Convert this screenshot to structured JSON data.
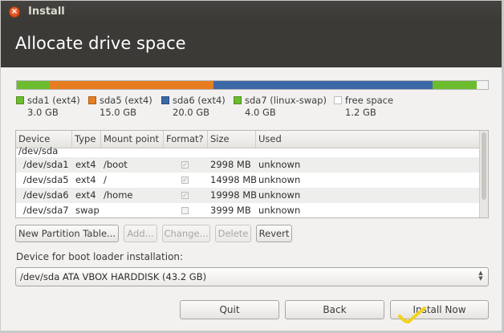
{
  "window": {
    "title": "Install",
    "close_icon": "close-icon"
  },
  "header": {
    "title": "Allocate drive space"
  },
  "partition_bar": {
    "segments": [
      {
        "name": "sda1",
        "fraction": 0.069,
        "color": "#6bbd2d"
      },
      {
        "name": "sda5",
        "fraction": 0.349,
        "color": "#e67d21"
      },
      {
        "name": "sda6",
        "fraction": 0.465,
        "color": "#3d68a6"
      },
      {
        "name": "sda7",
        "fraction": 0.093,
        "color": "#6bbd2d"
      },
      {
        "name": "free",
        "fraction": 0.024,
        "color": "#f4f4f4"
      }
    ]
  },
  "legend": [
    {
      "name": "sda1 (ext4)",
      "size": "3.0 GB",
      "color": "#6bbd2d"
    },
    {
      "name": "sda5 (ext4)",
      "size": "15.0 GB",
      "color": "#e67d21"
    },
    {
      "name": "sda6 (ext4)",
      "size": "20.0 GB",
      "color": "#3d68a6"
    },
    {
      "name": "sda7 (linux-swap)",
      "size": "4.0 GB",
      "color": "#6bbd2d"
    },
    {
      "name": "free space",
      "size": "1.2 GB",
      "color": "#ffffff"
    }
  ],
  "table": {
    "headers": [
      "Device",
      "Type",
      "Mount point",
      "Format?",
      "Size",
      "Used"
    ],
    "group": "/dev/sda",
    "rows": [
      {
        "device": "/dev/sda1",
        "type": "ext4",
        "mount": "/boot",
        "format": true,
        "size": "2998 MB",
        "used": "unknown"
      },
      {
        "device": "/dev/sda5",
        "type": "ext4",
        "mount": "/",
        "format": true,
        "size": "14998 MB",
        "used": "unknown"
      },
      {
        "device": "/dev/sda6",
        "type": "ext4",
        "mount": "/home",
        "format": true,
        "size": "19998 MB",
        "used": "unknown"
      },
      {
        "device": "/dev/sda7",
        "type": "swap",
        "mount": "",
        "format": false,
        "size": "3999 MB",
        "used": "unknown"
      }
    ]
  },
  "partition_buttons": {
    "new_table": "New Partition Table...",
    "add": "Add...",
    "change": "Change...",
    "delete": "Delete",
    "revert": "Revert"
  },
  "boot_loader": {
    "label": "Device for boot loader installation:",
    "selected": "/dev/sda ATA VBOX HARDDISK (43.2 GB)"
  },
  "footer_buttons": {
    "quit": "Quit",
    "back": "Back",
    "install_now": "Install Now"
  },
  "annotation": {
    "checkmark_color": "#f2d21b"
  }
}
